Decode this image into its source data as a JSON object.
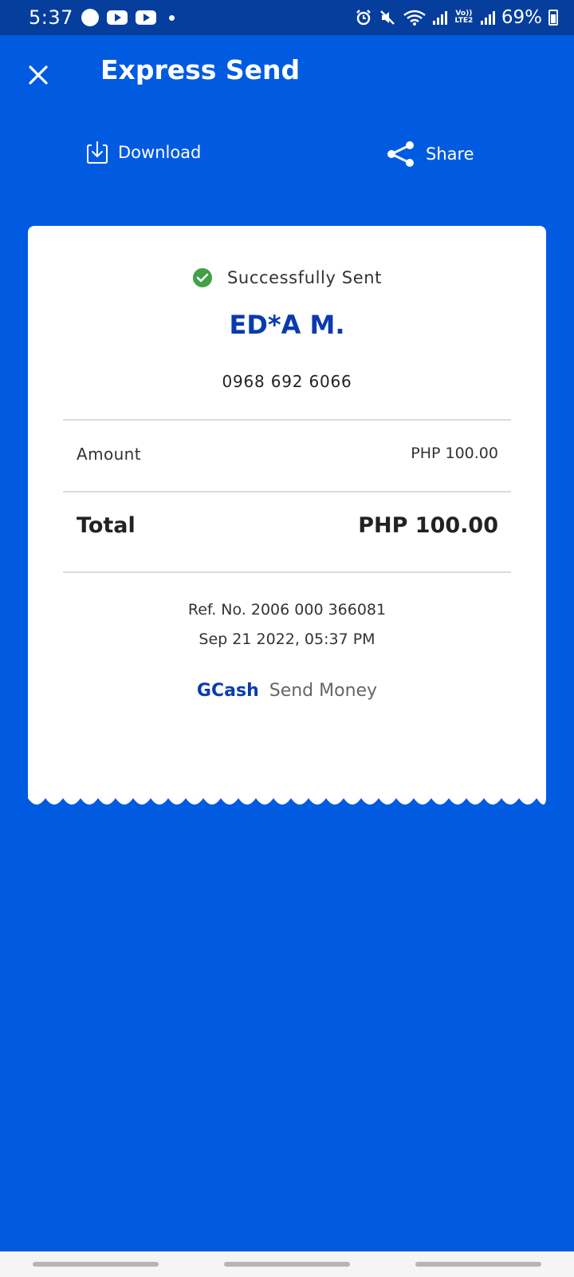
{
  "status_bar": {
    "time": "5:37",
    "battery": "69%",
    "lte_label": "Vo)) LTE2"
  },
  "header": {
    "title": "Express Send",
    "close_icon": "close-icon"
  },
  "actions": {
    "download_label": "Download",
    "share_label": "Share"
  },
  "receipt": {
    "status_text": "Successfully Sent",
    "recipient_name": "ED*A M.",
    "recipient_number": "0968 692 6066",
    "amount_label": "Amount",
    "amount_value": "PHP 100.00",
    "total_label": "Total",
    "total_value": "PHP 100.00",
    "ref_no": "Ref. No. 2006 000 366081",
    "date_time": "Sep 21 2022, 05:37 PM",
    "brand_name": "GCash",
    "brand_product": "Send Money"
  },
  "colors": {
    "background": "#015BE0",
    "status_bar": "#053E9C",
    "accent_text": "#0A3BAE",
    "success_green": "#43A047"
  }
}
